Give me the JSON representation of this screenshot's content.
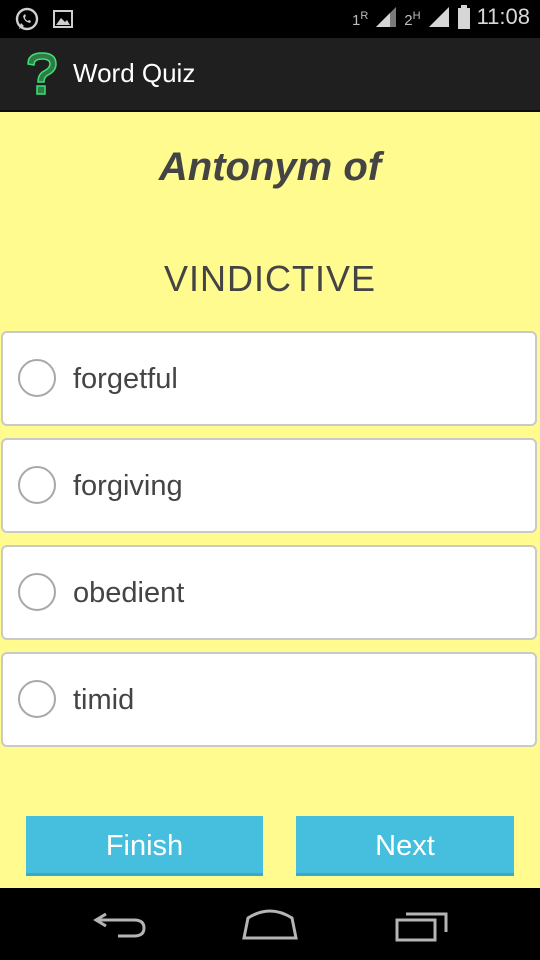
{
  "status_bar": {
    "time": "11:08",
    "sim1_label": "1",
    "sim1_sup": "R",
    "sim2_label": "2",
    "sim2_sup": "H",
    "icons": [
      "whatsapp-icon",
      "image-icon",
      "signal-icon",
      "battery-icon"
    ]
  },
  "action_bar": {
    "title": "Word Quiz",
    "logo_icon": "question-mark-icon"
  },
  "quiz": {
    "heading": "Antonym of",
    "word": "VINDICTIVE",
    "options": [
      {
        "label": "forgetful",
        "selected": false
      },
      {
        "label": "forgiving",
        "selected": false
      },
      {
        "label": "obedient",
        "selected": false
      },
      {
        "label": "timid",
        "selected": false
      }
    ]
  },
  "buttons": {
    "finish": "Finish",
    "next": "Next"
  },
  "nav_bar": {
    "icons": [
      "back-icon",
      "home-icon",
      "recent-apps-icon"
    ]
  },
  "colors": {
    "background": "#fffb8f",
    "button": "#46bedd",
    "action_bar": "#1f1f1f"
  }
}
